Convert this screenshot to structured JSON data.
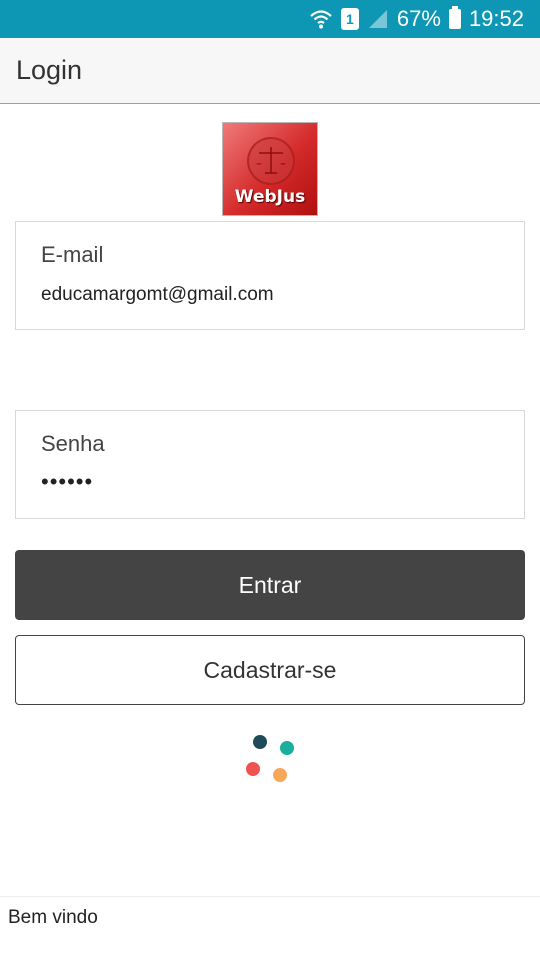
{
  "status_bar": {
    "battery": "67%",
    "time": "19:52",
    "sim": "1",
    "color": "#0d97b4"
  },
  "app_bar": {
    "title": "Login"
  },
  "logo": {
    "text": "WebJus"
  },
  "form": {
    "email_label": "E-mail",
    "email_value": "educamargomt@gmail.com",
    "password_label": "Senha",
    "password_value": "••••••"
  },
  "buttons": {
    "login": "Entrar",
    "register": "Cadastrar-se"
  },
  "footer": {
    "text": "Bem vindo"
  },
  "colors": {
    "primary_button": "#444444",
    "spinner": [
      "#1e4a5a",
      "#1aaf9c",
      "#ef5350",
      "#f6a75a"
    ]
  }
}
